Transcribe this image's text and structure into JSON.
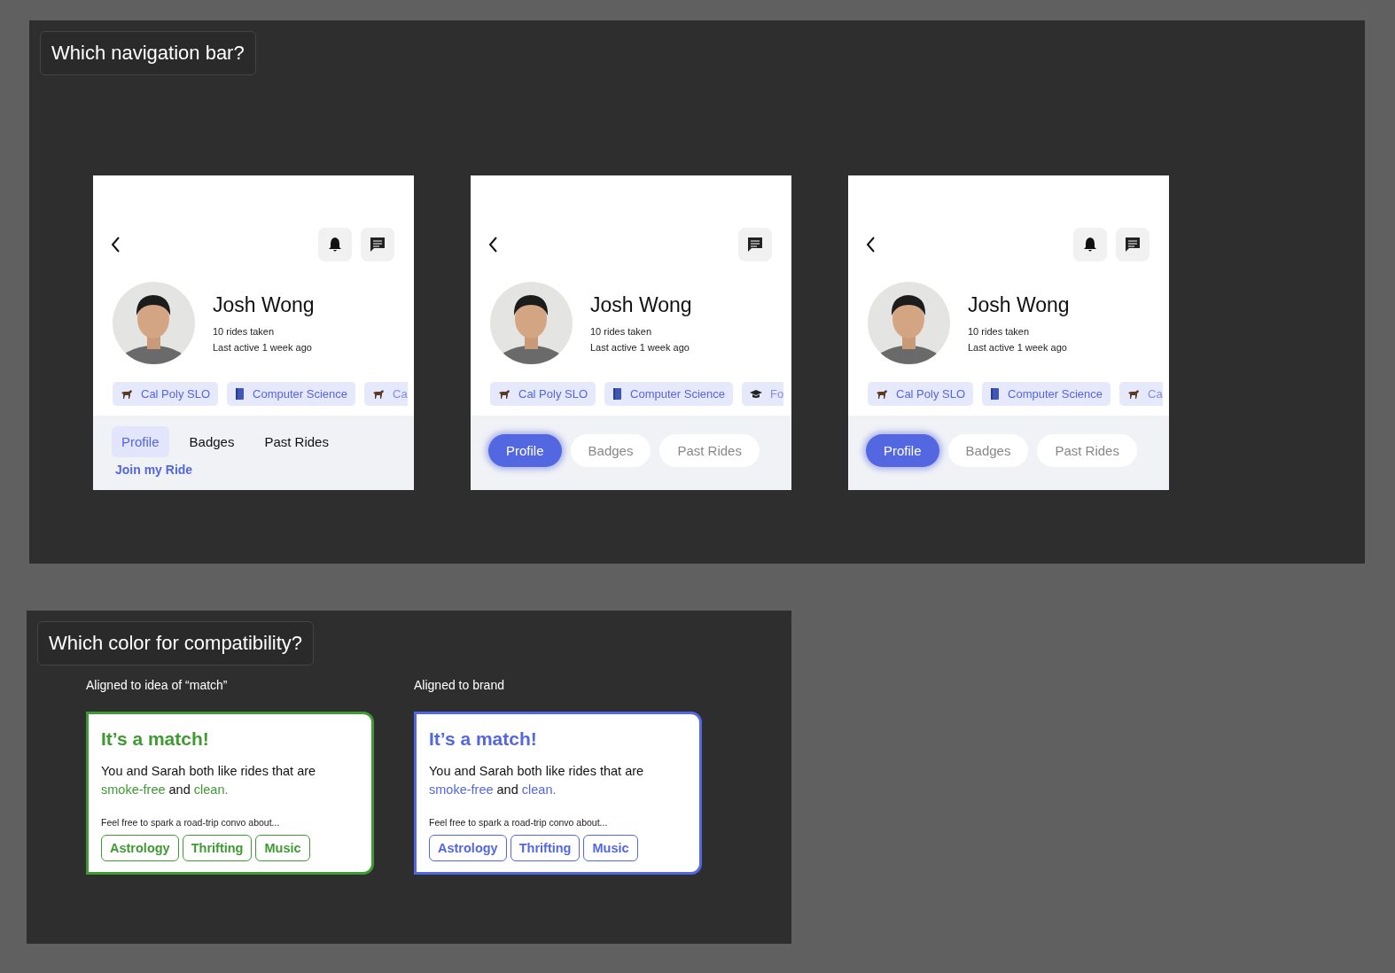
{
  "navigation": {
    "title": "Which navigation bar?",
    "variants": [
      {
        "kind": "text-tabs",
        "notifications_button": true,
        "name": "Josh Wong",
        "stats": [
          "10 rides taken",
          "Last active 1 week ago"
        ],
        "chips": [
          {
            "kind": "horse",
            "label": "Cal Poly SLO"
          },
          {
            "kind": "book",
            "label": "Computer Science"
          },
          {
            "kind": "horse",
            "label": "Ca"
          }
        ],
        "tabs": [
          {
            "label": "Profile",
            "selected": true
          },
          {
            "label": "Badges",
            "selected": false
          },
          {
            "label": "Past Rides",
            "selected": false
          }
        ],
        "footer_link": "Join my Ride"
      },
      {
        "kind": "pill-tabs",
        "notifications_button": false,
        "name": "Josh Wong",
        "stats": [
          "10 rides taken",
          "Last active 1 week ago"
        ],
        "chips": [
          {
            "kind": "horse",
            "label": "Cal Poly SLO"
          },
          {
            "kind": "book",
            "label": "Computer Science"
          },
          {
            "kind": "cap",
            "label": "Fo"
          }
        ],
        "tabs": [
          {
            "label": "Profile",
            "selected": true
          },
          {
            "label": "Badges",
            "selected": false
          },
          {
            "label": "Past Rides",
            "selected": false
          }
        ]
      },
      {
        "kind": "pill-tabs",
        "notifications_button": true,
        "name": "Josh Wong",
        "stats": [
          "10 rides taken",
          "Last active 1 week ago"
        ],
        "chips": [
          {
            "kind": "horse",
            "label": "Cal Poly SLO"
          },
          {
            "kind": "book",
            "label": "Computer Science"
          },
          {
            "kind": "horse",
            "label": "Ca"
          }
        ],
        "tabs": [
          {
            "label": "Profile",
            "selected": true
          },
          {
            "label": "Badges",
            "selected": false
          },
          {
            "label": "Past Rides",
            "selected": false
          }
        ]
      }
    ]
  },
  "compatibility": {
    "title": "Which color for compatibility?",
    "options": [
      {
        "caption": "Aligned to idea of “match”",
        "color": "#3f9a34",
        "heading": "It’s a match!",
        "body": [
          {
            "text": "You and Sarah both like rides that are ",
            "highlight": false
          },
          {
            "text": "smoke-free",
            "highlight": true
          },
          {
            "text": " and ",
            "highlight": false
          },
          {
            "text": "clean.",
            "highlight": true
          }
        ],
        "prompt": "Feel free to spark a road-trip convo about...",
        "topics": [
          "Astrology",
          "Thrifting",
          "Music"
        ]
      },
      {
        "caption": "Aligned to brand",
        "color": "#5367e0",
        "heading": "It’s a match!",
        "body": [
          {
            "text": "You and Sarah both like rides that are ",
            "highlight": false
          },
          {
            "text": "smoke-free",
            "highlight": true
          },
          {
            "text": " and ",
            "highlight": false
          },
          {
            "text": "clean.",
            "highlight": true
          }
        ],
        "prompt": "Feel free to spark a road-trip convo about...",
        "topics": [
          "Astrology",
          "Thrifting",
          "Music"
        ]
      }
    ]
  }
}
